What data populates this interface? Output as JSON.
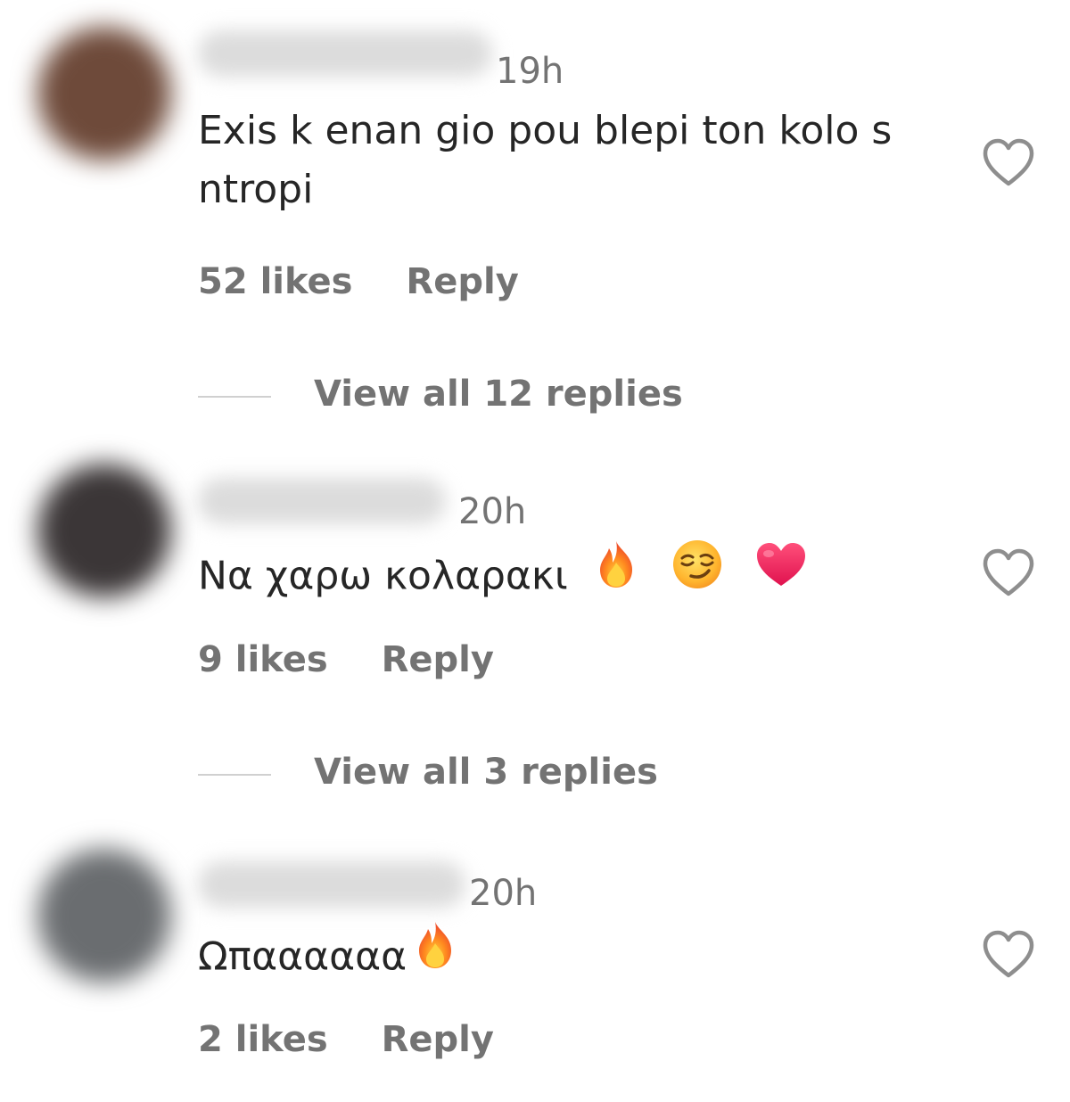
{
  "colors": {
    "primary_text": "#262626",
    "secondary_text": "#737373",
    "background": "#ffffff",
    "avatar_1": "#6e4a3a",
    "avatar_2": "#3b3637",
    "avatar_3": "#6a6d70"
  },
  "comments": [
    {
      "time": "19h",
      "text": "Exis k enan gio pou blepi ton kolo s ntropi",
      "emojis": [],
      "likes": "52 likes",
      "reply_label": "Reply",
      "like_icon": "heart-outline-icon",
      "view_replies": "View all 12 replies"
    },
    {
      "time": "20h",
      "text": "Να χαρω κολαρακι",
      "emojis": [
        "fire-icon",
        "smirking-face-icon",
        "red-heart-icon"
      ],
      "likes": "9 likes",
      "reply_label": "Reply",
      "like_icon": "heart-outline-icon",
      "view_replies": "View all 3 replies"
    },
    {
      "time": "20h",
      "text": "Ωπαααααα",
      "emojis": [
        "fire-icon"
      ],
      "likes": "2 likes",
      "reply_label": "Reply",
      "like_icon": "heart-outline-icon"
    }
  ]
}
